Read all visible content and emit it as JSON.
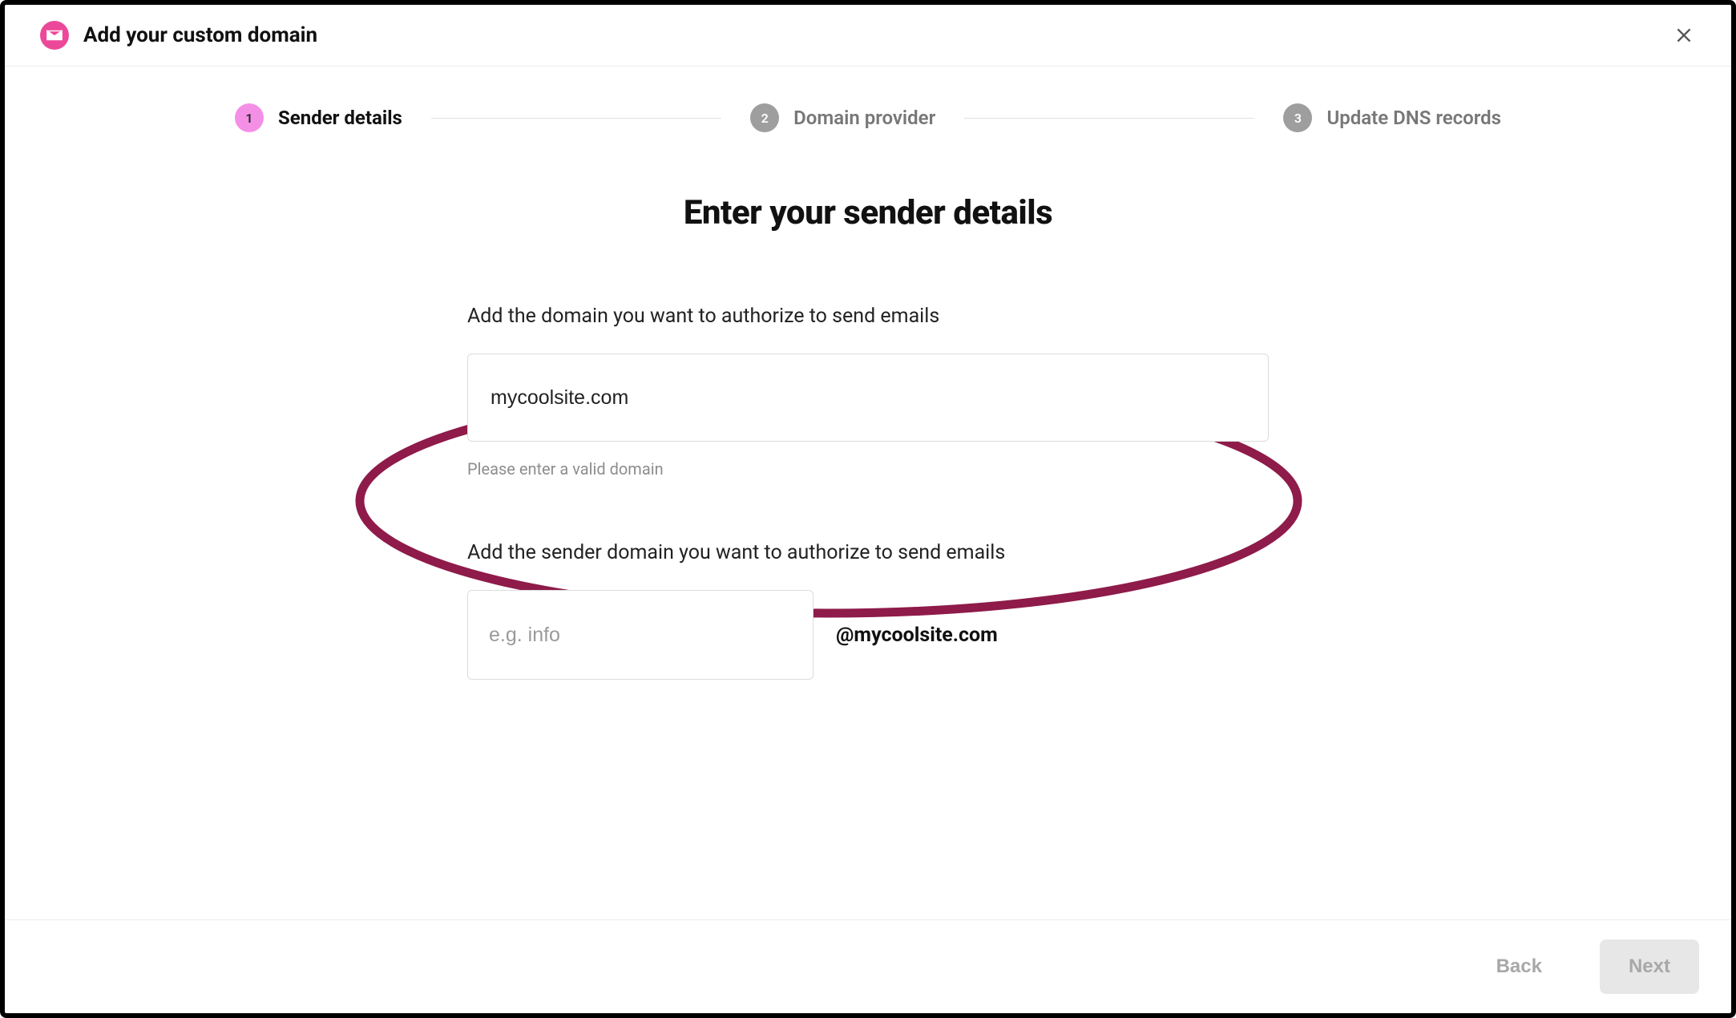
{
  "header": {
    "title": "Add your custom domain"
  },
  "stepper": {
    "steps": [
      {
        "num": "1",
        "label": "Sender details",
        "active": true
      },
      {
        "num": "2",
        "label": "Domain provider",
        "active": false
      },
      {
        "num": "3",
        "label": "Update DNS records",
        "active": false
      }
    ]
  },
  "main": {
    "heading": "Enter your sender details",
    "domain_label": "Add the domain you want to authorize to send emails",
    "domain_value": "mycoolsite.com",
    "domain_helper": "Please enter a valid domain",
    "sender_label": "Add the sender domain you want to authorize to send emails",
    "sender_placeholder": "e.g. info",
    "sender_value": "",
    "domain_suffix": "@mycoolsite.com"
  },
  "footer": {
    "back_label": "Back",
    "next_label": "Next"
  },
  "colors": {
    "accent_pink": "#ec4899",
    "step_active_bg": "#f48fe6",
    "annotation_stroke": "#8e1b4a"
  }
}
